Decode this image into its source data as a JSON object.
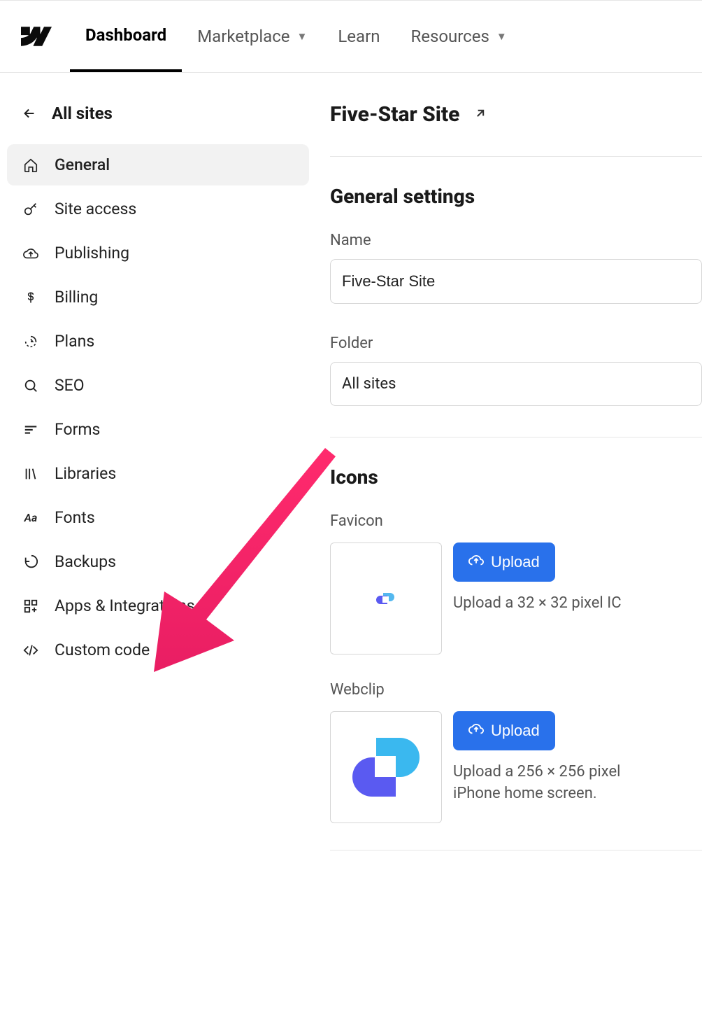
{
  "nav": {
    "dashboard": "Dashboard",
    "marketplace": "Marketplace",
    "learn": "Learn",
    "resources": "Resources"
  },
  "sidebar": {
    "back_label": "All sites",
    "items": [
      {
        "label": "General"
      },
      {
        "label": "Site access"
      },
      {
        "label": "Publishing"
      },
      {
        "label": "Billing"
      },
      {
        "label": "Plans"
      },
      {
        "label": "SEO"
      },
      {
        "label": "Forms"
      },
      {
        "label": "Libraries"
      },
      {
        "label": "Fonts"
      },
      {
        "label": "Backups"
      },
      {
        "label": "Apps & Integrations"
      },
      {
        "label": "Custom code"
      }
    ]
  },
  "main": {
    "site_title": "Five-Star Site",
    "general_heading": "General settings",
    "name_label": "Name",
    "name_value": "Five-Star Site",
    "folder_label": "Folder",
    "folder_value": "All sites",
    "icons_heading": "Icons",
    "favicon_label": "Favicon",
    "favicon_upload": "Upload",
    "favicon_hint": "Upload a 32 × 32 pixel IC",
    "webclip_label": "Webclip",
    "webclip_upload": "Upload",
    "webclip_hint_line1": "Upload a 256 × 256 pixel",
    "webclip_hint_line2": "iPhone home screen."
  }
}
